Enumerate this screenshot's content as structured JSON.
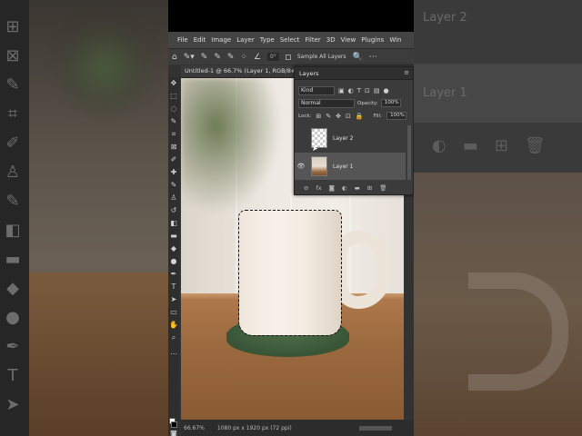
{
  "menu": {
    "items": [
      "File",
      "Edit",
      "Image",
      "Layer",
      "Type",
      "Select",
      "Filter",
      "3D",
      "View",
      "Plugins",
      "Win"
    ]
  },
  "options_bar": {
    "angle_value": "0°",
    "sample_all_layers_label": "Sample All Layers"
  },
  "document": {
    "tab_title": "Untitled-1 @ 66.7% (Layer 1, RGB/8#) *"
  },
  "status": {
    "zoom": "66.67%",
    "doc_size": "1080 px x 1920 px (72 ppi)"
  },
  "layers_panel": {
    "title": "Layers",
    "filter_kind": "Kind",
    "blend_mode": "Normal",
    "opacity_label": "Opacity:",
    "opacity_value": "100%",
    "lock_label": "Lock:",
    "fill_label": "Fill:",
    "fill_value": "100%",
    "layers": [
      {
        "name": "Layer 2",
        "visible": false,
        "selected": false
      },
      {
        "name": "Layer 1",
        "visible": true,
        "selected": true
      }
    ],
    "footer_icons": [
      "link-icon",
      "fx-icon",
      "mask-icon",
      "adjustment-icon",
      "group-icon",
      "new-layer-icon",
      "trash-icon"
    ]
  },
  "background_ghost": {
    "layer_names": [
      "Layer 2",
      "Layer 1"
    ]
  },
  "colors": {
    "ui_dark": "#323232",
    "panel": "#3b3b3b",
    "selection_row": "#555555",
    "mug": "#f3ece2",
    "coaster": "#3d5a3b",
    "table": "#9c6a3f"
  }
}
